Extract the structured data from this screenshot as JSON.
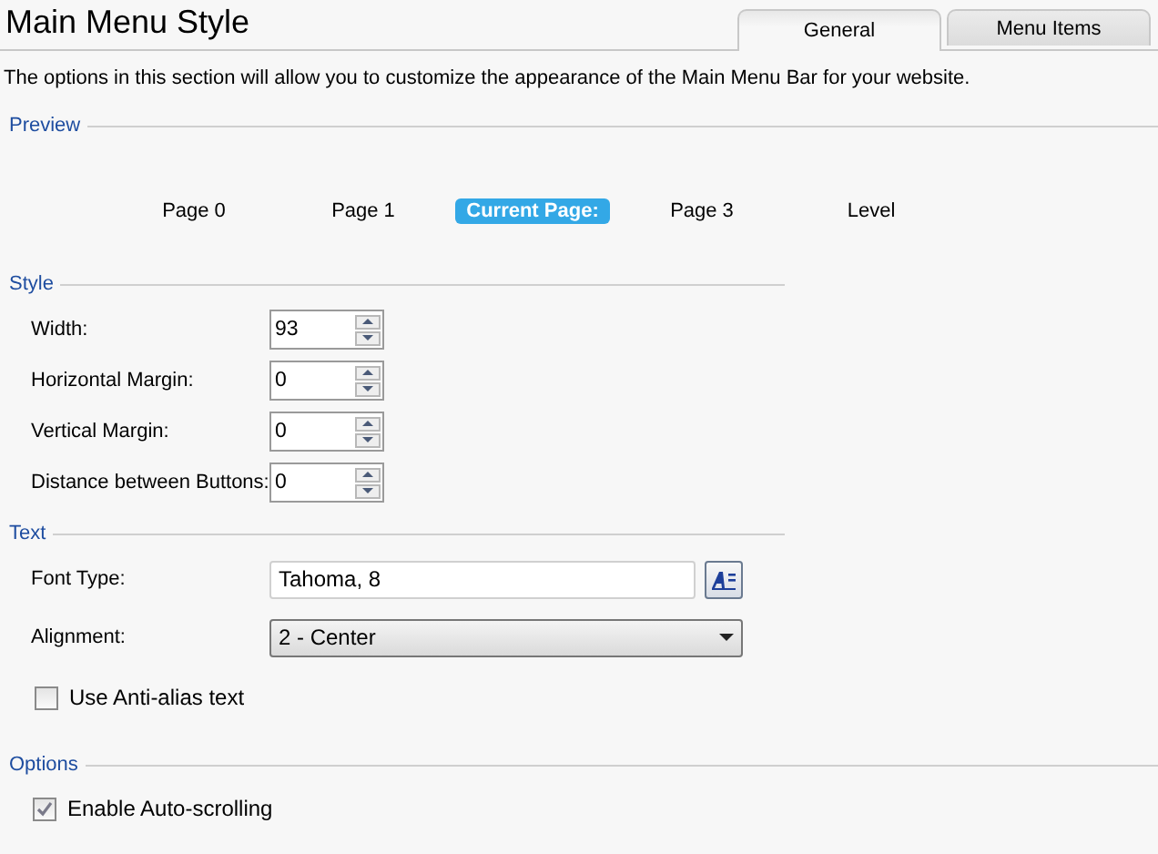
{
  "title": "Main Menu Style",
  "tabs": [
    {
      "label": "General",
      "selected": true
    },
    {
      "label": "Menu Items",
      "selected": false
    }
  ],
  "description": "The options in this section will allow you to customize the appearance of the Main Menu Bar for your website.",
  "preview": {
    "legend": "Preview",
    "items": [
      {
        "label": "Page 0",
        "selected": false
      },
      {
        "label": "Page 1",
        "selected": false
      },
      {
        "label": "Current Page:",
        "selected": true
      },
      {
        "label": "Page 3",
        "selected": false
      },
      {
        "label": "Level",
        "selected": false
      }
    ]
  },
  "style": {
    "legend": "Style",
    "fields": [
      {
        "label": "Width:",
        "value": "93"
      },
      {
        "label": "Horizontal Margin:",
        "value": "0"
      },
      {
        "label": "Vertical Margin:",
        "value": "0"
      },
      {
        "label": "Distance between Buttons:",
        "value": "0"
      }
    ]
  },
  "text": {
    "legend": "Text",
    "font_type": {
      "label": "Font Type:",
      "value": "Tahoma, 8"
    },
    "alignment": {
      "label": "Alignment:",
      "value": "2 - Center"
    },
    "anti_alias": {
      "label": "Use Anti-alias text",
      "checked": false
    }
  },
  "options": {
    "legend": "Options",
    "auto_scrolling": {
      "label": "Enable Auto-scrolling",
      "checked": true
    }
  }
}
